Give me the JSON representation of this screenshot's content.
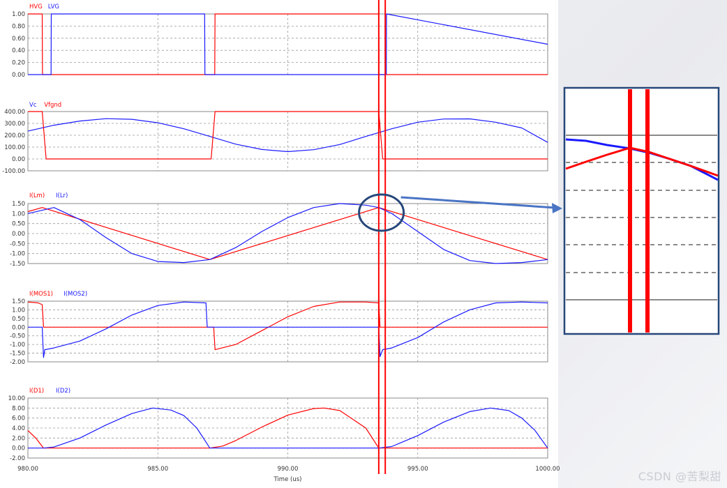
{
  "colors": {
    "red": "#ff0000",
    "blue": "#1a1aff",
    "zoom_frame": "#26477a",
    "arrow": "#4a74c4",
    "grid": "#999999"
  },
  "watermark": "CSDN @苦梨甜",
  "x_axis": {
    "label": "Time (us)",
    "range": [
      980,
      1000
    ],
    "ticks": [
      "980.00",
      "985.00",
      "990.00",
      "995.00",
      "1000.00"
    ]
  },
  "cursors_us": [
    993.5,
    993.75
  ],
  "zoom_inset": {
    "annotation": "magnified view of I(Lm) / I(Lr) crossing near the cursors"
  },
  "chart_data": [
    {
      "type": "line",
      "legend": [
        {
          "label": "HVG",
          "color": "#ff0000"
        },
        {
          "label": "LVG",
          "color": "#1a1aff"
        }
      ],
      "ylim": [
        0,
        1
      ],
      "yticks": [
        "1.00",
        "0.80",
        "0.60",
        "0.40",
        "0.20",
        "0.00"
      ],
      "series": [
        {
          "name": "HVG",
          "color": "#ff0000",
          "description": "gate drive high 980.0-980.55 and 987.2-993.5, otherwise 0",
          "x": [
            980.0,
            980.55,
            980.56,
            987.19,
            987.2,
            993.5,
            993.51,
            1000.0
          ],
          "y": [
            1,
            1,
            0,
            0,
            1,
            1,
            0,
            0
          ]
        },
        {
          "name": "LVG",
          "color": "#1a1aff",
          "description": "gate drive high 980.9-986.8 and 993.8-1000, otherwise 0",
          "x": [
            980.0,
            980.89,
            980.9,
            986.8,
            986.81,
            993.79,
            993.8,
            1000.0
          ],
          "y": [
            0,
            0,
            1,
            1,
            0,
            0,
            1,
            0.5
          ]
        }
      ]
    },
    {
      "type": "line",
      "legend": [
        {
          "label": "Vc",
          "color": "#1a1aff"
        },
        {
          "label": "Vfgnd",
          "color": "#ff0000"
        }
      ],
      "ylim": [
        -100,
        400
      ],
      "yticks": [
        "400.00",
        "300.00",
        "200.00",
        "100.00",
        "0.00",
        "-100.00"
      ],
      "series": [
        {
          "name": "Vc",
          "color": "#1a1aff",
          "x": [
            980,
            981,
            982,
            983,
            984,
            985,
            986,
            987,
            988,
            989,
            990,
            991,
            992,
            993,
            994,
            995,
            996,
            997,
            998,
            999,
            1000
          ],
          "y": [
            235,
            285,
            320,
            340,
            335,
            305,
            255,
            190,
            125,
            80,
            62,
            78,
            122,
            190,
            255,
            310,
            337,
            338,
            310,
            262,
            140
          ]
        },
        {
          "name": "Vfgnd",
          "color": "#ff0000",
          "x": [
            980.0,
            980.55,
            980.7,
            987.05,
            987.2,
            993.5,
            993.65,
            1000.0
          ],
          "y": [
            400,
            400,
            0,
            0,
            400,
            400,
            0,
            0
          ]
        }
      ]
    },
    {
      "type": "line",
      "legend": [
        {
          "label": "I(Lm)",
          "color": "#ff0000"
        },
        {
          "label": "I(Lr)",
          "color": "#1a1aff"
        }
      ],
      "ylim": [
        -1.5,
        1.5
      ],
      "yticks": [
        "1.50",
        "1.00",
        "0.50",
        "0.00",
        "-0.50",
        "-1.00",
        "-1.50"
      ],
      "series": [
        {
          "name": "I(Lm)",
          "color": "#ff0000",
          "x": [
            980.0,
            980.55,
            987.0,
            993.5,
            1000.0
          ],
          "y": [
            1.1,
            1.3,
            -1.3,
            1.3,
            -1.3
          ]
        },
        {
          "name": "I(Lr)",
          "color": "#1a1aff",
          "x": [
            980,
            981,
            982,
            983,
            984,
            985,
            986,
            987,
            988,
            989,
            990,
            991,
            992,
            993,
            993.5,
            994,
            995,
            996,
            997,
            998,
            999,
            1000
          ],
          "y": [
            1.0,
            1.3,
            0.7,
            -0.2,
            -1.0,
            -1.4,
            -1.45,
            -1.3,
            -0.7,
            0.1,
            0.8,
            1.3,
            1.5,
            1.42,
            1.3,
            1.0,
            0.1,
            -0.8,
            -1.35,
            -1.5,
            -1.45,
            -1.3
          ]
        }
      ]
    },
    {
      "type": "line",
      "legend": [
        {
          "label": "I(MOS1)",
          "color": "#ff0000"
        },
        {
          "label": "I(MOS2)",
          "color": "#1a1aff"
        }
      ],
      "ylim": [
        -2,
        1.5
      ],
      "yticks": [
        "1.50",
        "1.00",
        "0.50",
        "0.00",
        "-0.50",
        "-1.00",
        "-1.50",
        "-2.00"
      ],
      "series": [
        {
          "name": "I(MOS1)",
          "color": "#ff0000",
          "x": [
            980.0,
            980.4,
            980.55,
            980.6,
            987.15,
            987.2,
            988,
            989,
            990,
            991,
            992,
            993,
            993.5,
            993.55,
            1000.0
          ],
          "y": [
            1.45,
            1.4,
            1.3,
            0,
            0,
            -1.3,
            -1.0,
            -0.2,
            0.6,
            1.2,
            1.45,
            1.45,
            1.4,
            0,
            0
          ]
        },
        {
          "name": "I(MOS2)",
          "color": "#1a1aff",
          "x": [
            980.0,
            980.55,
            980.6,
            980.65,
            981,
            982,
            983,
            984,
            985,
            986,
            986.85,
            986.9,
            987.0,
            993.5,
            993.55,
            993.65,
            994,
            995,
            996,
            997,
            998,
            999,
            1000
          ],
          "y": [
            0,
            0,
            -1.75,
            -1.3,
            -1.2,
            -0.8,
            -0.1,
            0.7,
            1.25,
            1.45,
            1.4,
            0,
            0,
            0,
            -1.7,
            -1.3,
            -1.2,
            -0.6,
            0.3,
            1.0,
            1.4,
            1.45,
            1.4
          ]
        }
      ]
    },
    {
      "type": "line",
      "legend": [
        {
          "label": "I(D1)",
          "color": "#ff0000"
        },
        {
          "label": "I(D2)",
          "color": "#1a1aff"
        }
      ],
      "ylim": [
        -2,
        10
      ],
      "yticks": [
        "10.00",
        "8.00",
        "6.00",
        "4.00",
        "2.00",
        "0.00",
        "-2.00"
      ],
      "series": [
        {
          "name": "I(D1)",
          "color": "#ff0000",
          "x": [
            980.0,
            980.3,
            980.6,
            987.0,
            987.5,
            988.0,
            989.0,
            990.0,
            991.0,
            991.4,
            992.0,
            993.0,
            993.5,
            1000.0
          ],
          "y": [
            3.5,
            2.0,
            0,
            0,
            0.4,
            1.5,
            4.2,
            6.6,
            7.9,
            8.0,
            7.5,
            4.0,
            0,
            0
          ]
        },
        {
          "name": "I(D2)",
          "color": "#1a1aff",
          "x": [
            980.0,
            980.6,
            981.0,
            982.0,
            983.0,
            984.0,
            984.8,
            985.5,
            986.0,
            986.5,
            987.0,
            993.5,
            994.0,
            995.0,
            996.0,
            997.0,
            997.8,
            998.5,
            999.0,
            999.5,
            1000.0
          ],
          "y": [
            0,
            0,
            0.2,
            2.0,
            4.6,
            6.9,
            8.0,
            7.6,
            6.5,
            4.0,
            0,
            0,
            0.3,
            2.5,
            5.2,
            7.3,
            8.0,
            7.5,
            6.0,
            3.6,
            0
          ]
        }
      ]
    }
  ]
}
